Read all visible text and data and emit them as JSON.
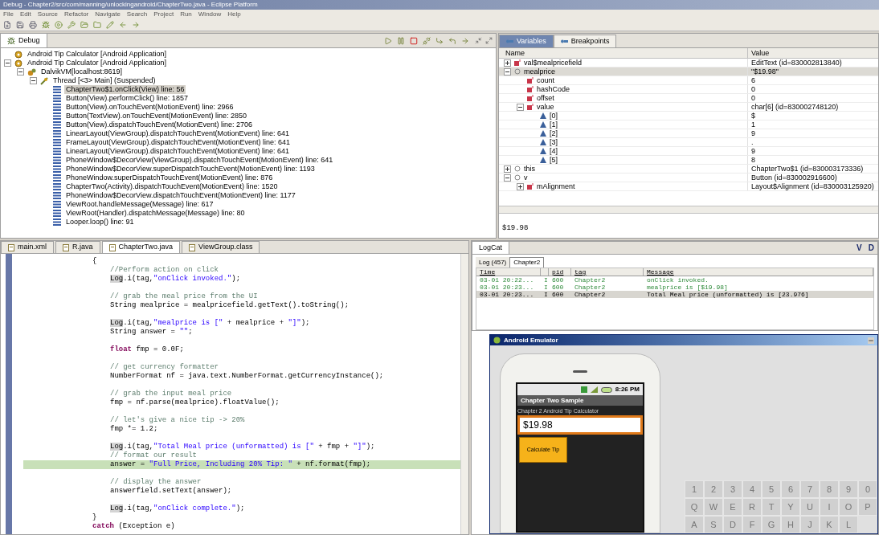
{
  "window": {
    "title": "Debug - Chapter2/src/com/manning/unlockingandroid/ChapterTwo.java - Eclipse Platform"
  },
  "menu": [
    "File",
    "Edit",
    "Source",
    "Refactor",
    "Navigate",
    "Search",
    "Project",
    "Run",
    "Window",
    "Help"
  ],
  "debug": {
    "tab": "Debug",
    "tree": [
      {
        "label": "Android Tip Calculator [Android Application]",
        "kind": "app"
      },
      {
        "label": "Android Tip Calculator [Android Application]",
        "kind": "app",
        "expanded": true,
        "children": [
          {
            "label": "DalvikVM[localhost:8619]",
            "kind": "vm",
            "expanded": true,
            "children": [
              {
                "label": "Thread [<3> Main] (Suspended)",
                "kind": "thread",
                "expanded": true,
                "children": [
                  {
                    "label": "ChapterTwo$1.onClick(View) line: 56",
                    "kind": "frame",
                    "selected": true
                  },
                  {
                    "label": "Button(View).performClick() line: 1857",
                    "kind": "frame",
                    "selected": false
                  },
                  {
                    "label": "Button(View).onTouchEvent(MotionEvent) line: 2966",
                    "kind": "frame",
                    "selected": false
                  },
                  {
                    "label": "Button(TextView).onTouchEvent(MotionEvent) line: 2850",
                    "kind": "frame",
                    "selected": false
                  },
                  {
                    "label": "Button(View).dispatchTouchEvent(MotionEvent) line: 2706",
                    "kind": "frame",
                    "selected": false
                  },
                  {
                    "label": "LinearLayout(ViewGroup).dispatchTouchEvent(MotionEvent) line: 641",
                    "kind": "frame",
                    "selected": false
                  },
                  {
                    "label": "FrameLayout(ViewGroup).dispatchTouchEvent(MotionEvent) line: 641",
                    "kind": "frame",
                    "selected": false
                  },
                  {
                    "label": "LinearLayout(ViewGroup).dispatchTouchEvent(MotionEvent) line: 641",
                    "kind": "frame",
                    "selected": false
                  },
                  {
                    "label": "PhoneWindow$DecorView(ViewGroup).dispatchTouchEvent(MotionEvent) line: 641",
                    "kind": "frame",
                    "selected": false
                  },
                  {
                    "label": "PhoneWindow$DecorView.superDispatchTouchEvent(MotionEvent) line: 1193",
                    "kind": "frame",
                    "selected": false
                  },
                  {
                    "label": "PhoneWindow.superDispatchTouchEvent(MotionEvent) line: 876",
                    "kind": "frame",
                    "selected": false
                  },
                  {
                    "label": "ChapterTwo(Activity).dispatchTouchEvent(MotionEvent) line: 1520",
                    "kind": "frame",
                    "selected": false
                  },
                  {
                    "label": "PhoneWindow$DecorView.dispatchTouchEvent(MotionEvent) line: 1177",
                    "kind": "frame",
                    "selected": false
                  },
                  {
                    "label": "ViewRoot.handleMessage(Message) line: 617",
                    "kind": "frame",
                    "selected": false
                  },
                  {
                    "label": "ViewRoot(Handler).dispatchMessage(Message) line: 80",
                    "kind": "frame",
                    "selected": false
                  },
                  {
                    "label": "Looper.loop() line: 91",
                    "kind": "frame",
                    "selected": false
                  }
                ]
              }
            ]
          }
        ]
      }
    ]
  },
  "variables": {
    "tabs": [
      {
        "label": "Variables",
        "selected": true
      },
      {
        "label": "Breakpoints",
        "selected": false
      }
    ],
    "columns": [
      "Name",
      "Value"
    ],
    "rows": [
      {
        "name": "val$mealpricefield",
        "value": "EditText (id=830002813840)",
        "kind": "field",
        "expanded": false,
        "selected": false
      },
      {
        "name": "mealprice",
        "value": "\"$19.98\"",
        "kind": "local",
        "expanded": true,
        "selected": true,
        "children": [
          {
            "name": "count",
            "value": "6",
            "kind": "field",
            "selected": false
          },
          {
            "name": "hashCode",
            "value": "0",
            "kind": "field",
            "selected": false
          },
          {
            "name": "offset",
            "value": "0",
            "kind": "field",
            "selected": false
          },
          {
            "name": "value",
            "value": "char[6] (id=830002748120)",
            "kind": "field",
            "expanded": true,
            "selected": false,
            "children": [
              {
                "name": "[0]",
                "value": "$",
                "kind": "element",
                "selected": false
              },
              {
                "name": "[1]",
                "value": "1",
                "kind": "element",
                "selected": false
              },
              {
                "name": "[2]",
                "value": "9",
                "kind": "element",
                "selected": false
              },
              {
                "name": "[3]",
                "value": ".",
                "kind": "element",
                "selected": false
              },
              {
                "name": "[4]",
                "value": "9",
                "kind": "element",
                "selected": false
              },
              {
                "name": "[5]",
                "value": "8",
                "kind": "element",
                "selected": false
              }
            ]
          }
        ]
      },
      {
        "name": "this",
        "value": "ChapterTwo$1 (id=830003173336)",
        "kind": "local",
        "expanded": false,
        "selected": false
      },
      {
        "name": "v",
        "value": "Button (id=830002916600)",
        "kind": "local",
        "expanded": true,
        "selected": false,
        "children": [
          {
            "name": "mAlignment",
            "value": "Layout$Alignment (id=830003125920)",
            "kind": "field",
            "expanded": false,
            "selected": false
          }
        ]
      }
    ],
    "detail": "$19.98"
  },
  "editor": {
    "tabs": [
      {
        "label": "main.xml",
        "selected": false
      },
      {
        "label": "R.java",
        "selected": false
      },
      {
        "label": "ChapterTwo.java",
        "selected": true
      },
      {
        "label": "ViewGroup.class",
        "selected": false
      }
    ],
    "lines": [
      {
        "kind": "outer",
        "current": false,
        "tokens": [
          {
            "text": "{",
            "kind": "plain"
          }
        ]
      },
      {
        "kind": "inner",
        "current": false,
        "tokens": [
          {
            "text": "//Perform action on click",
            "kind": "comment"
          }
        ]
      },
      {
        "kind": "inner",
        "current": false,
        "tokens": [
          {
            "text": "Log",
            "kind": "marked"
          },
          {
            "text": ".i(tag,",
            "kind": "plain"
          },
          {
            "text": "\"onClick invoked.\"",
            "kind": "string"
          },
          {
            "text": ");",
            "kind": "plain"
          }
        ]
      },
      {
        "kind": "blank"
      },
      {
        "kind": "inner",
        "current": false,
        "tokens": [
          {
            "text": "// grab the meal price from the UI",
            "kind": "comment"
          }
        ]
      },
      {
        "kind": "inner",
        "current": false,
        "tokens": [
          {
            "text": "String mealprice = mealpricefield.getText().toString();",
            "kind": "plain"
          }
        ]
      },
      {
        "kind": "blank"
      },
      {
        "kind": "inner",
        "current": false,
        "tokens": [
          {
            "text": "Log",
            "kind": "marked"
          },
          {
            "text": ".i(tag,",
            "kind": "plain"
          },
          {
            "text": "\"mealprice is [\"",
            "kind": "string"
          },
          {
            "text": " + mealprice + ",
            "kind": "plain"
          },
          {
            "text": "\"]\"",
            "kind": "string"
          },
          {
            "text": ");",
            "kind": "plain"
          }
        ]
      },
      {
        "kind": "inner",
        "current": false,
        "tokens": [
          {
            "text": "String answer = ",
            "kind": "plain"
          },
          {
            "text": "\"\"",
            "kind": "string"
          },
          {
            "text": ";",
            "kind": "plain"
          }
        ]
      },
      {
        "kind": "blank"
      },
      {
        "kind": "inner",
        "current": false,
        "tokens": [
          {
            "text": "float",
            "kind": "keyword"
          },
          {
            "text": " fmp = 0.0F;",
            "kind": "plain"
          }
        ]
      },
      {
        "kind": "blank"
      },
      {
        "kind": "inner",
        "current": false,
        "tokens": [
          {
            "text": "// get currency formatter",
            "kind": "comment"
          }
        ]
      },
      {
        "kind": "inner",
        "current": false,
        "tokens": [
          {
            "text": "NumberFormat nf = java.text.NumberFormat.getCurrencyInstance();",
            "kind": "plain"
          }
        ]
      },
      {
        "kind": "blank"
      },
      {
        "kind": "inner",
        "current": false,
        "tokens": [
          {
            "text": "// grab the input meal price",
            "kind": "comment"
          }
        ]
      },
      {
        "kind": "inner",
        "current": false,
        "tokens": [
          {
            "text": "fmp = nf.parse(mealprice).floatValue();",
            "kind": "plain"
          }
        ]
      },
      {
        "kind": "blank"
      },
      {
        "kind": "inner",
        "current": false,
        "tokens": [
          {
            "text": "// let's give a nice tip -> 20%",
            "kind": "comment"
          }
        ]
      },
      {
        "kind": "inner",
        "current": false,
        "tokens": [
          {
            "text": "fmp *= 1.2;",
            "kind": "plain"
          }
        ]
      },
      {
        "kind": "blank"
      },
      {
        "kind": "inner",
        "current": false,
        "tokens": [
          {
            "text": "Log",
            "kind": "marked"
          },
          {
            "text": ".i(tag,",
            "kind": "plain"
          },
          {
            "text": "\"Total Meal price (unformatted) is [\"",
            "kind": "string"
          },
          {
            "text": " + fmp + ",
            "kind": "plain"
          },
          {
            "text": "\"]\"",
            "kind": "string"
          },
          {
            "text": ");",
            "kind": "plain"
          }
        ]
      },
      {
        "kind": "inner",
        "current": false,
        "tokens": [
          {
            "text": "// format our result",
            "kind": "comment"
          }
        ]
      },
      {
        "kind": "inner",
        "current": true,
        "tokens": [
          {
            "text": "answer = ",
            "kind": "plain"
          },
          {
            "text": "\"Full Price, Including 20% Tip: \"",
            "kind": "string"
          },
          {
            "text": " + nf.format(fmp);",
            "kind": "plain"
          }
        ]
      },
      {
        "kind": "blank"
      },
      {
        "kind": "inner",
        "current": false,
        "tokens": [
          {
            "text": "// display the answer",
            "kind": "comment"
          }
        ]
      },
      {
        "kind": "inner",
        "current": false,
        "tokens": [
          {
            "text": "answerfield.setText(answer);",
            "kind": "plain"
          }
        ]
      },
      {
        "kind": "blank"
      },
      {
        "kind": "inner",
        "current": false,
        "tokens": [
          {
            "text": "Log",
            "kind": "marked"
          },
          {
            "text": ".i(tag,",
            "kind": "plain"
          },
          {
            "text": "\"onClick complete.\"",
            "kind": "string"
          },
          {
            "text": ");",
            "kind": "plain"
          }
        ]
      },
      {
        "kind": "outer",
        "current": false,
        "tokens": [
          {
            "text": "}",
            "kind": "plain"
          }
        ]
      },
      {
        "kind": "outer",
        "current": false,
        "tokens": [
          {
            "text": "catch",
            "kind": "keyword"
          },
          {
            "text": " (Exception e)",
            "kind": "plain"
          }
        ]
      }
    ]
  },
  "logcat": {
    "tab": "LogCat",
    "level_buttons": [
      "V",
      "D"
    ],
    "filters": [
      {
        "label": "Log (457)",
        "selected": false
      },
      {
        "label": "Chapter2",
        "selected": true
      }
    ],
    "columns": [
      "Time",
      "",
      "pid",
      "tag",
      "Message"
    ],
    "rows": [
      {
        "time": "03-01 20:22...",
        "level": "I",
        "pid": "600",
        "tag": "Chapter2",
        "message": "onClick invoked.",
        "selected": false
      },
      {
        "time": "03-01 20:23...",
        "level": "I",
        "pid": "600",
        "tag": "Chapter2",
        "message": "mealprice is [$19.98]",
        "selected": false
      },
      {
        "time": "03-01 20:23...",
        "level": "I",
        "pid": "600",
        "tag": "Chapter2",
        "message": "Total Meal price (unformatted) is [23.976]",
        "selected": true
      }
    ]
  },
  "emulator": {
    "title": "Android Emulator",
    "status_time": "8:26 PM",
    "app_title": "Chapter Two Sample",
    "label": "Chapter 2 Android Tip Calculator",
    "field_value": "$19.98",
    "button": "Calculate Tip",
    "keyboard": [
      [
        "1",
        "2",
        "3",
        "4",
        "5",
        "6",
        "7",
        "8",
        "9",
        "0"
      ],
      [
        "Q",
        "W",
        "E",
        "R",
        "T",
        "Y",
        "U",
        "I",
        "O",
        "P"
      ],
      [
        "A",
        "S",
        "D",
        "F",
        "G",
        "H",
        "J",
        "K",
        "L"
      ]
    ]
  }
}
